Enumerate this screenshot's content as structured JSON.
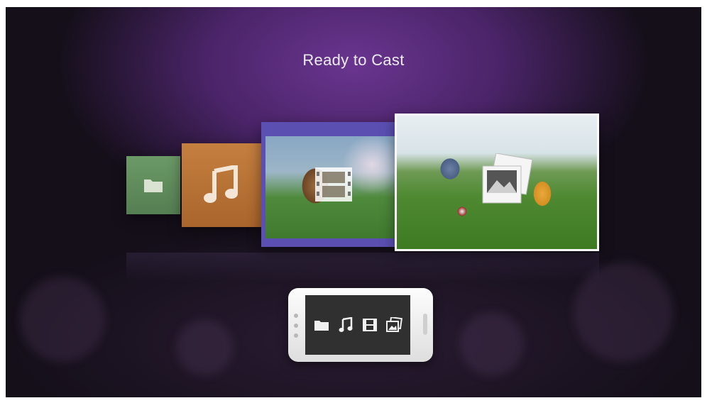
{
  "header": {
    "title": "Ready to Cast"
  },
  "cards": [
    {
      "id": "folder",
      "icon": "folder-icon",
      "color": "#6c9a67"
    },
    {
      "id": "music",
      "icon": "music-note-icon",
      "color": "#c57f3f"
    },
    {
      "id": "video",
      "icon": "film-icon",
      "color": "#5b4fb2"
    },
    {
      "id": "photo",
      "icon": "photo-icon",
      "color": "#fafafa"
    }
  ],
  "phone": {
    "icons": [
      "folder-icon",
      "music-note-icon",
      "film-icon",
      "photo-icon"
    ]
  }
}
